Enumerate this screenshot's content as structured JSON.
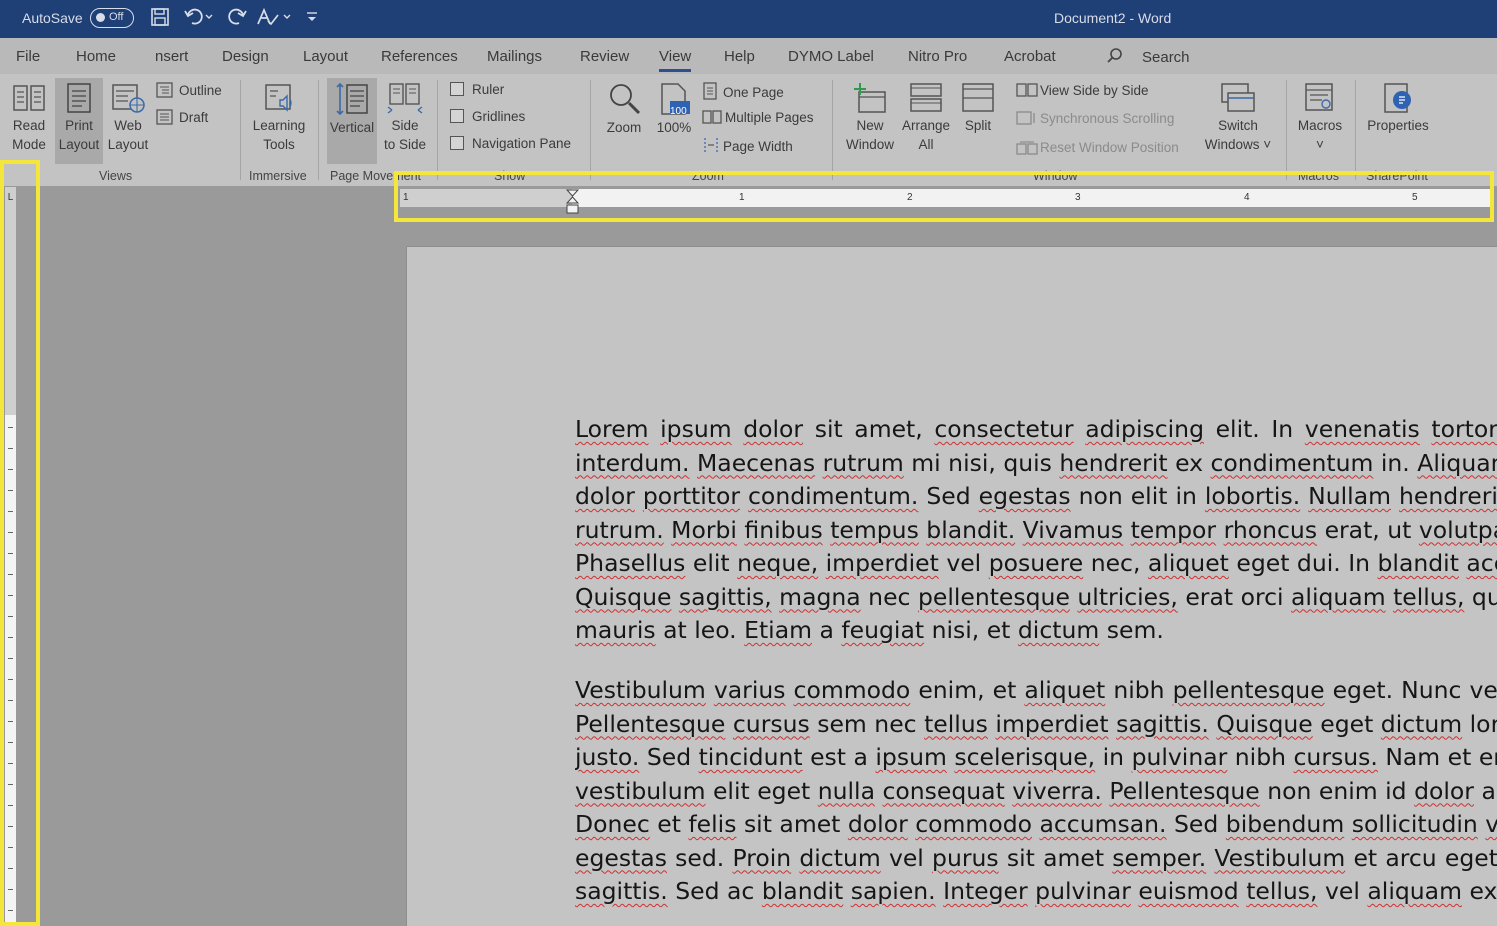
{
  "titlebar": {
    "autosave_label": "AutoSave",
    "autosave_state": "Off",
    "doc_title": "Document2 - Word"
  },
  "tabs": [
    {
      "label": "File"
    },
    {
      "label": "Home"
    },
    {
      "label": "nsert"
    },
    {
      "label": "Design"
    },
    {
      "label": "Layout"
    },
    {
      "label": "References"
    },
    {
      "label": "Mailings"
    },
    {
      "label": "Review"
    },
    {
      "label": "View"
    },
    {
      "label": "Help"
    },
    {
      "label": "DYMO Label"
    },
    {
      "label": "Nitro Pro"
    },
    {
      "label": "Acrobat"
    }
  ],
  "search_label": "Search",
  "ribbon": {
    "views": {
      "read_mode": [
        "Read",
        "Mode"
      ],
      "print_layout": [
        "Print",
        "Layout"
      ],
      "web_layout": [
        "Web",
        "Layout"
      ],
      "outline": "Outline",
      "draft": "Draft",
      "group": "Views"
    },
    "immersive": {
      "learning_tools": [
        "Learning",
        "Tools"
      ],
      "group": "Immersive"
    },
    "page_movement": {
      "vertical": [
        "Vertical"
      ],
      "side_to_side": [
        "Side",
        "to Side"
      ],
      "group": "Page Movement"
    },
    "show": {
      "ruler": "Ruler",
      "gridlines": "Gridlines",
      "navigation_pane": "Navigation Pane",
      "group": "Show"
    },
    "zoom": {
      "zoom": [
        "Zoom"
      ],
      "hundred": [
        "100%"
      ],
      "hundred_icon_text": "100",
      "one_page": "One Page",
      "multiple_pages": "Multiple Pages",
      "page_width": "Page Width",
      "group": "Zoom"
    },
    "window": {
      "new_window": [
        "New",
        "Window"
      ],
      "arrange_all": [
        "Arrange",
        "All"
      ],
      "split": [
        "Split"
      ],
      "view_side_by_side": "View Side by Side",
      "synchronous_scrolling": "Synchronous Scrolling",
      "reset_window_position": "Reset Window Position",
      "switch_windows": [
        "Switch",
        "Windows ˅"
      ],
      "group": "Window"
    },
    "macros": {
      "macros": [
        "Macros",
        "˅"
      ],
      "group": "Macros"
    },
    "sharepoint": {
      "properties": [
        "Properties"
      ],
      "group": "SharePoint"
    }
  },
  "ruler": {
    "left_label": "1",
    "numbers": [
      "1",
      "2",
      "3",
      "4",
      "5"
    ],
    "tab_selector": "L"
  },
  "document": {
    "paragraphs": [
      [
        "Lorem ipsum dolor sit amet, consectetur adipiscing elit. In venenatis tortor",
        "interdum. Maecenas rutrum mi nisi, quis hendrerit ex condimentum in. Aliquam r",
        "dolor porttitor condimentum. Sed egestas non elit in lobortis. Nullam hendreri",
        "rutrum. Morbi finibus tempus blandit. Vivamus tempor rhoncus erat, ut volutpat",
        "Phasellus elit neque, imperdiet vel posuere nec, aliquet eget dui. In blandit accum",
        "Quisque sagittis, magna nec pellentesque ultricies, erat orci aliquam tellus, qu",
        "mauris at leo. Etiam a feugiat nisi, et dictum sem."
      ],
      [
        "Vestibulum varius commodo enim, et aliquet nibh pellentesque eget. Nunc ve",
        "Pellentesque cursus sem nec tellus imperdiet sagittis. Quisque eget dictum lor",
        "justo. Sed tincidunt est a ipsum scelerisque, in pulvinar nibh cursus. Nam et enim",
        "vestibulum elit eget nulla consequat viverra. Pellentesque non enim id dolor ali",
        "Donec et felis sit amet dolor commodo accumsan. Sed bibendum sollicitudin velit,",
        "egestas sed. Proin dictum vel purus sit amet semper. Vestibulum et arcu eget",
        "sagittis. Sed ac blandit sapien. Integer pulvinar euismod tellus, vel aliquam ex ege"
      ]
    ]
  },
  "icons": {
    "save": "save-icon",
    "undo": "undo-icon",
    "redo": "redo-icon",
    "spell": "spelling-icon",
    "customize": "customize-qat-icon",
    "search": "search-icon"
  },
  "colors": {
    "titlebar": "#1f3f77",
    "highlight": "#f5e63b",
    "active_tab": "#2b4f8f",
    "spelling_underline": "#d03030"
  }
}
